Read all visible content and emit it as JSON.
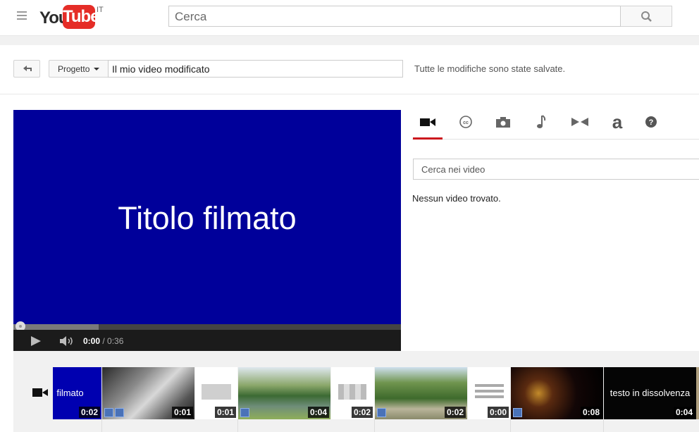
{
  "header": {
    "logo_you": "You",
    "logo_tube": "Tube",
    "country": "IT",
    "search_placeholder": "Cerca"
  },
  "toolbar": {
    "project_label": "Progetto",
    "project_name": "Il mio video modificato",
    "save_status": "Tutte le modifiche sono state salvate."
  },
  "player": {
    "title_text": "Titolo filmato",
    "current_time": "0:00",
    "duration": "/ 0:36",
    "progress_fraction": 0.0,
    "buffered_fraction": 0.22
  },
  "panel": {
    "tabs": [
      {
        "icon": "video-camera-icon",
        "active": true
      },
      {
        "icon": "cc-icon",
        "active": false
      },
      {
        "icon": "photo-camera-icon",
        "active": false
      },
      {
        "icon": "music-note-icon",
        "active": false
      },
      {
        "icon": "transition-icon",
        "active": false
      },
      {
        "icon": "text-icon",
        "active": false
      },
      {
        "icon": "help-icon",
        "active": false
      }
    ],
    "search_placeholder": "Cerca nei video",
    "empty_message": "Nessun video trovato."
  },
  "timeline": {
    "clips": [
      {
        "label": "filmato",
        "duration": "0:02"
      },
      {
        "duration": "0:01"
      },
      {
        "duration": "0:01"
      },
      {
        "duration": "0:04"
      },
      {
        "duration": "0:02"
      },
      {
        "duration": "0:02"
      },
      {
        "duration": "0:00"
      },
      {
        "duration": "0:08"
      },
      {
        "label": "testo in dissolvenza",
        "duration": "0:04"
      }
    ]
  },
  "colors": {
    "brand_red": "#e52d27",
    "title_card_blue": "#00009a",
    "active_tab": "#cc181e"
  }
}
